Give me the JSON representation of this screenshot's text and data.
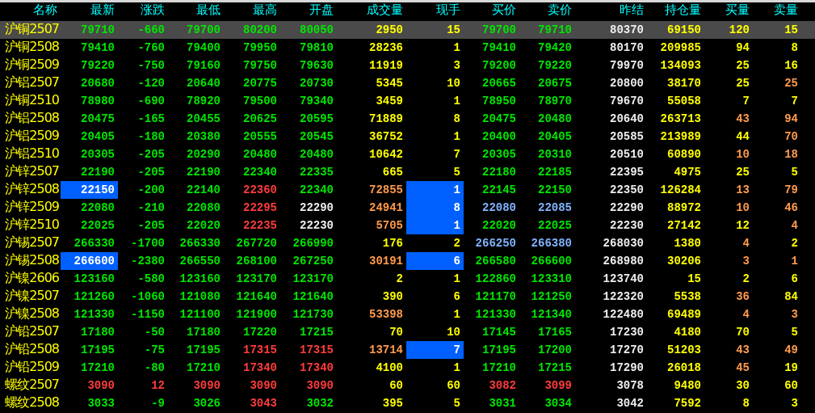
{
  "columns": [
    "名称",
    "最新",
    "涨跌",
    "最低",
    "最高",
    "开盘",
    "成交量",
    "现手",
    "买价",
    "卖价",
    "昨结",
    "持仓量",
    "买量",
    "卖量"
  ],
  "rows": [
    {
      "name": "沪铜2507",
      "selected": true,
      "cells": [
        {
          "text": "79710",
          "color": "#00e600",
          "highlighted": false
        },
        {
          "text": "-660",
          "color": "#00e600",
          "highlighted": false
        },
        {
          "text": "79700",
          "color": "#00e600",
          "highlighted": false
        },
        {
          "text": "80200",
          "color": "#00e600",
          "highlighted": false
        },
        {
          "text": "80050",
          "color": "#00e600",
          "highlighted": false
        },
        {
          "text": "2950",
          "color": "#ffff00",
          "highlighted": false
        },
        {
          "text": "15",
          "color": "#ffff00",
          "highlighted": false
        },
        {
          "text": "79700",
          "color": "#00e600",
          "highlighted": false
        },
        {
          "text": "79710",
          "color": "#00e600",
          "highlighted": false
        },
        {
          "text": "80370",
          "color": "#eeeeee",
          "highlighted": false
        },
        {
          "text": "69150",
          "color": "#ffff00",
          "highlighted": false
        },
        {
          "text": "120",
          "color": "#ffff00",
          "highlighted": false
        },
        {
          "text": "15",
          "color": "#ffff00",
          "highlighted": false
        }
      ]
    },
    {
      "name": "沪铜2508",
      "selected": false,
      "cells": [
        {
          "text": "79410",
          "color": "#00e600",
          "highlighted": false
        },
        {
          "text": "-760",
          "color": "#00e600",
          "highlighted": false
        },
        {
          "text": "79400",
          "color": "#00e600",
          "highlighted": false
        },
        {
          "text": "79950",
          "color": "#00e600",
          "highlighted": false
        },
        {
          "text": "79810",
          "color": "#00e600",
          "highlighted": false
        },
        {
          "text": "28236",
          "color": "#ffff00",
          "highlighted": false
        },
        {
          "text": "1",
          "color": "#ffff00",
          "highlighted": false
        },
        {
          "text": "79410",
          "color": "#00e600",
          "highlighted": false
        },
        {
          "text": "79420",
          "color": "#00e600",
          "highlighted": false
        },
        {
          "text": "80170",
          "color": "#eeeeee",
          "highlighted": false
        },
        {
          "text": "209985",
          "color": "#ffff00",
          "highlighted": false
        },
        {
          "text": "94",
          "color": "#ffff00",
          "highlighted": false
        },
        {
          "text": "8",
          "color": "#ffff00",
          "highlighted": false
        }
      ]
    },
    {
      "name": "沪铜2509",
      "selected": false,
      "cells": [
        {
          "text": "79220",
          "color": "#00e600",
          "highlighted": false
        },
        {
          "text": "-750",
          "color": "#00e600",
          "highlighted": false
        },
        {
          "text": "79160",
          "color": "#00e600",
          "highlighted": false
        },
        {
          "text": "79750",
          "color": "#00e600",
          "highlighted": false
        },
        {
          "text": "79630",
          "color": "#00e600",
          "highlighted": false
        },
        {
          "text": "11919",
          "color": "#ffff00",
          "highlighted": false
        },
        {
          "text": "3",
          "color": "#ffff00",
          "highlighted": false
        },
        {
          "text": "79200",
          "color": "#00e600",
          "highlighted": false
        },
        {
          "text": "79220",
          "color": "#00e600",
          "highlighted": false
        },
        {
          "text": "79970",
          "color": "#eeeeee",
          "highlighted": false
        },
        {
          "text": "134093",
          "color": "#ffff00",
          "highlighted": false
        },
        {
          "text": "25",
          "color": "#ffff00",
          "highlighted": false
        },
        {
          "text": "16",
          "color": "#ffff00",
          "highlighted": false
        }
      ]
    },
    {
      "name": "沪铝2507",
      "selected": false,
      "cells": [
        {
          "text": "20680",
          "color": "#00e600",
          "highlighted": false
        },
        {
          "text": "-120",
          "color": "#00e600",
          "highlighted": false
        },
        {
          "text": "20640",
          "color": "#00e600",
          "highlighted": false
        },
        {
          "text": "20775",
          "color": "#00e600",
          "highlighted": false
        },
        {
          "text": "20730",
          "color": "#00e600",
          "highlighted": false
        },
        {
          "text": "5345",
          "color": "#ffff00",
          "highlighted": false
        },
        {
          "text": "10",
          "color": "#ffff00",
          "highlighted": false
        },
        {
          "text": "20665",
          "color": "#00e600",
          "highlighted": false
        },
        {
          "text": "20675",
          "color": "#00e600",
          "highlighted": false
        },
        {
          "text": "20800",
          "color": "#eeeeee",
          "highlighted": false
        },
        {
          "text": "38170",
          "color": "#ffff00",
          "highlighted": false
        },
        {
          "text": "25",
          "color": "#ffff00",
          "highlighted": false
        },
        {
          "text": "25",
          "color": "#ff9a4c",
          "highlighted": false
        }
      ]
    },
    {
      "name": "沪铜2510",
      "selected": false,
      "cells": [
        {
          "text": "78980",
          "color": "#00e600",
          "highlighted": false
        },
        {
          "text": "-690",
          "color": "#00e600",
          "highlighted": false
        },
        {
          "text": "78920",
          "color": "#00e600",
          "highlighted": false
        },
        {
          "text": "79500",
          "color": "#00e600",
          "highlighted": false
        },
        {
          "text": "79340",
          "color": "#00e600",
          "highlighted": false
        },
        {
          "text": "3459",
          "color": "#ffff00",
          "highlighted": false
        },
        {
          "text": "1",
          "color": "#ffff00",
          "highlighted": false
        },
        {
          "text": "78950",
          "color": "#00e600",
          "highlighted": false
        },
        {
          "text": "78970",
          "color": "#00e600",
          "highlighted": false
        },
        {
          "text": "79670",
          "color": "#eeeeee",
          "highlighted": false
        },
        {
          "text": "55058",
          "color": "#ffff00",
          "highlighted": false
        },
        {
          "text": "7",
          "color": "#ffff00",
          "highlighted": false
        },
        {
          "text": "7",
          "color": "#ffff00",
          "highlighted": false
        }
      ]
    },
    {
      "name": "沪铝2508",
      "selected": false,
      "cells": [
        {
          "text": "20475",
          "color": "#00e600",
          "highlighted": false
        },
        {
          "text": "-165",
          "color": "#00e600",
          "highlighted": false
        },
        {
          "text": "20455",
          "color": "#00e600",
          "highlighted": false
        },
        {
          "text": "20625",
          "color": "#00e600",
          "highlighted": false
        },
        {
          "text": "20595",
          "color": "#00e600",
          "highlighted": false
        },
        {
          "text": "71889",
          "color": "#ffff00",
          "highlighted": false
        },
        {
          "text": "8",
          "color": "#ffff00",
          "highlighted": false
        },
        {
          "text": "20475",
          "color": "#00e600",
          "highlighted": false
        },
        {
          "text": "20480",
          "color": "#00e600",
          "highlighted": false
        },
        {
          "text": "20640",
          "color": "#eeeeee",
          "highlighted": false
        },
        {
          "text": "263713",
          "color": "#ffff00",
          "highlighted": false
        },
        {
          "text": "43",
          "color": "#ff9a4c",
          "highlighted": false
        },
        {
          "text": "94",
          "color": "#ff9a4c",
          "highlighted": false
        }
      ]
    },
    {
      "name": "沪铝2509",
      "selected": false,
      "cells": [
        {
          "text": "20405",
          "color": "#00e600",
          "highlighted": false
        },
        {
          "text": "-180",
          "color": "#00e600",
          "highlighted": false
        },
        {
          "text": "20380",
          "color": "#00e600",
          "highlighted": false
        },
        {
          "text": "20555",
          "color": "#00e600",
          "highlighted": false
        },
        {
          "text": "20545",
          "color": "#00e600",
          "highlighted": false
        },
        {
          "text": "36752",
          "color": "#ffff00",
          "highlighted": false
        },
        {
          "text": "1",
          "color": "#ffff00",
          "highlighted": false
        },
        {
          "text": "20400",
          "color": "#00e600",
          "highlighted": false
        },
        {
          "text": "20405",
          "color": "#00e600",
          "highlighted": false
        },
        {
          "text": "20585",
          "color": "#eeeeee",
          "highlighted": false
        },
        {
          "text": "213989",
          "color": "#ffff00",
          "highlighted": false
        },
        {
          "text": "44",
          "color": "#ffff00",
          "highlighted": false
        },
        {
          "text": "70",
          "color": "#ff9a4c",
          "highlighted": false
        }
      ]
    },
    {
      "name": "沪铝2510",
      "selected": false,
      "cells": [
        {
          "text": "20305",
          "color": "#00e600",
          "highlighted": false
        },
        {
          "text": "-205",
          "color": "#00e600",
          "highlighted": false
        },
        {
          "text": "20290",
          "color": "#00e600",
          "highlighted": false
        },
        {
          "text": "20480",
          "color": "#00e600",
          "highlighted": false
        },
        {
          "text": "20480",
          "color": "#00e600",
          "highlighted": false
        },
        {
          "text": "10642",
          "color": "#ffff00",
          "highlighted": false
        },
        {
          "text": "7",
          "color": "#ffff00",
          "highlighted": false
        },
        {
          "text": "20305",
          "color": "#00e600",
          "highlighted": false
        },
        {
          "text": "20310",
          "color": "#00e600",
          "highlighted": false
        },
        {
          "text": "20510",
          "color": "#eeeeee",
          "highlighted": false
        },
        {
          "text": "60890",
          "color": "#ffff00",
          "highlighted": false
        },
        {
          "text": "10",
          "color": "#ff9a4c",
          "highlighted": false
        },
        {
          "text": "18",
          "color": "#ff9a4c",
          "highlighted": false
        }
      ]
    },
    {
      "name": "沪锌2507",
      "selected": false,
      "cells": [
        {
          "text": "22190",
          "color": "#00e600",
          "highlighted": false
        },
        {
          "text": "-205",
          "color": "#00e600",
          "highlighted": false
        },
        {
          "text": "22190",
          "color": "#00e600",
          "highlighted": false
        },
        {
          "text": "22340",
          "color": "#00e600",
          "highlighted": false
        },
        {
          "text": "22335",
          "color": "#00e600",
          "highlighted": false
        },
        {
          "text": "665",
          "color": "#ffff00",
          "highlighted": false
        },
        {
          "text": "5",
          "color": "#ffff00",
          "highlighted": false
        },
        {
          "text": "22180",
          "color": "#00e600",
          "highlighted": false
        },
        {
          "text": "22185",
          "color": "#00e600",
          "highlighted": false
        },
        {
          "text": "22395",
          "color": "#eeeeee",
          "highlighted": false
        },
        {
          "text": "4975",
          "color": "#ffff00",
          "highlighted": false
        },
        {
          "text": "25",
          "color": "#ffff00",
          "highlighted": false
        },
        {
          "text": "5",
          "color": "#ffff00",
          "highlighted": false
        }
      ]
    },
    {
      "name": "沪锌2508",
      "selected": false,
      "cells": [
        {
          "text": "22150",
          "color": "#ffffff",
          "highlighted": true
        },
        {
          "text": "-200",
          "color": "#00e600",
          "highlighted": false
        },
        {
          "text": "22140",
          "color": "#00e600",
          "highlighted": false
        },
        {
          "text": "22360",
          "color": "#ff3c3c",
          "highlighted": false
        },
        {
          "text": "22340",
          "color": "#00e600",
          "highlighted": false
        },
        {
          "text": "72855",
          "color": "#ff9a4c",
          "highlighted": false
        },
        {
          "text": "1",
          "color": "#ffffff",
          "highlighted": true
        },
        {
          "text": "22145",
          "color": "#00e600",
          "highlighted": false
        },
        {
          "text": "22150",
          "color": "#00e600",
          "highlighted": false
        },
        {
          "text": "22350",
          "color": "#eeeeee",
          "highlighted": false
        },
        {
          "text": "126284",
          "color": "#ffff00",
          "highlighted": false
        },
        {
          "text": "13",
          "color": "#ff9a4c",
          "highlighted": false
        },
        {
          "text": "79",
          "color": "#ff9a4c",
          "highlighted": false
        }
      ]
    },
    {
      "name": "沪锌2509",
      "selected": false,
      "cells": [
        {
          "text": "22080",
          "color": "#00e600",
          "highlighted": false
        },
        {
          "text": "-210",
          "color": "#00e600",
          "highlighted": false
        },
        {
          "text": "22080",
          "color": "#00e600",
          "highlighted": false
        },
        {
          "text": "22295",
          "color": "#ff3c3c",
          "highlighted": false
        },
        {
          "text": "22290",
          "color": "#eeeeee",
          "highlighted": false
        },
        {
          "text": "24941",
          "color": "#ff9a4c",
          "highlighted": false
        },
        {
          "text": "8",
          "color": "#ffffff",
          "highlighted": true
        },
        {
          "text": "22080",
          "color": "#80b4ff",
          "highlighted": false
        },
        {
          "text": "22085",
          "color": "#80b4ff",
          "highlighted": false
        },
        {
          "text": "22290",
          "color": "#eeeeee",
          "highlighted": false
        },
        {
          "text": "88972",
          "color": "#ffff00",
          "highlighted": false
        },
        {
          "text": "10",
          "color": "#ff9a4c",
          "highlighted": false
        },
        {
          "text": "46",
          "color": "#ff9a4c",
          "highlighted": false
        }
      ]
    },
    {
      "name": "沪锌2510",
      "selected": false,
      "cells": [
        {
          "text": "22025",
          "color": "#00e600",
          "highlighted": false
        },
        {
          "text": "-205",
          "color": "#00e600",
          "highlighted": false
        },
        {
          "text": "22020",
          "color": "#00e600",
          "highlighted": false
        },
        {
          "text": "22235",
          "color": "#ff3c3c",
          "highlighted": false
        },
        {
          "text": "22230",
          "color": "#eeeeee",
          "highlighted": false
        },
        {
          "text": "5705",
          "color": "#ff9a4c",
          "highlighted": false
        },
        {
          "text": "1",
          "color": "#ffffff",
          "highlighted": true
        },
        {
          "text": "22020",
          "color": "#00e600",
          "highlighted": false
        },
        {
          "text": "22025",
          "color": "#00e600",
          "highlighted": false
        },
        {
          "text": "22230",
          "color": "#eeeeee",
          "highlighted": false
        },
        {
          "text": "27142",
          "color": "#ffff00",
          "highlighted": false
        },
        {
          "text": "12",
          "color": "#ffff00",
          "highlighted": false
        },
        {
          "text": "4",
          "color": "#ff9a4c",
          "highlighted": false
        }
      ]
    },
    {
      "name": "沪锡2507",
      "selected": false,
      "cells": [
        {
          "text": "266330",
          "color": "#00e600",
          "highlighted": false
        },
        {
          "text": "-1700",
          "color": "#00e600",
          "highlighted": false
        },
        {
          "text": "266330",
          "color": "#00e600",
          "highlighted": false
        },
        {
          "text": "267720",
          "color": "#00e600",
          "highlighted": false
        },
        {
          "text": "266990",
          "color": "#00e600",
          "highlighted": false
        },
        {
          "text": "176",
          "color": "#ffff00",
          "highlighted": false
        },
        {
          "text": "2",
          "color": "#ffff00",
          "highlighted": false
        },
        {
          "text": "266250",
          "color": "#80b4ff",
          "highlighted": false
        },
        {
          "text": "266380",
          "color": "#80b4ff",
          "highlighted": false
        },
        {
          "text": "268030",
          "color": "#eeeeee",
          "highlighted": false
        },
        {
          "text": "1380",
          "color": "#ffff00",
          "highlighted": false
        },
        {
          "text": "4",
          "color": "#ff9a4c",
          "highlighted": false
        },
        {
          "text": "2",
          "color": "#ffff00",
          "highlighted": false
        }
      ]
    },
    {
      "name": "沪锡2508",
      "selected": false,
      "cells": [
        {
          "text": "266600",
          "color": "#ffffff",
          "highlighted": true
        },
        {
          "text": "-2380",
          "color": "#00e600",
          "highlighted": false
        },
        {
          "text": "266550",
          "color": "#00e600",
          "highlighted": false
        },
        {
          "text": "268100",
          "color": "#00e600",
          "highlighted": false
        },
        {
          "text": "267250",
          "color": "#00e600",
          "highlighted": false
        },
        {
          "text": "30191",
          "color": "#ff9a4c",
          "highlighted": false
        },
        {
          "text": "6",
          "color": "#ffffff",
          "highlighted": true
        },
        {
          "text": "266580",
          "color": "#00e600",
          "highlighted": false
        },
        {
          "text": "266600",
          "color": "#00e600",
          "highlighted": false
        },
        {
          "text": "268980",
          "color": "#eeeeee",
          "highlighted": false
        },
        {
          "text": "30206",
          "color": "#ffff00",
          "highlighted": false
        },
        {
          "text": "3",
          "color": "#ff9a4c",
          "highlighted": false
        },
        {
          "text": "1",
          "color": "#ff9a4c",
          "highlighted": false
        }
      ]
    },
    {
      "name": "沪镍2606",
      "selected": false,
      "cells": [
        {
          "text": "123160",
          "color": "#00e600",
          "highlighted": false
        },
        {
          "text": "-580",
          "color": "#00e600",
          "highlighted": false
        },
        {
          "text": "123160",
          "color": "#00e600",
          "highlighted": false
        },
        {
          "text": "123170",
          "color": "#00e600",
          "highlighted": false
        },
        {
          "text": "123170",
          "color": "#00e600",
          "highlighted": false
        },
        {
          "text": "2",
          "color": "#ffff00",
          "highlighted": false
        },
        {
          "text": "1",
          "color": "#ffff00",
          "highlighted": false
        },
        {
          "text": "122860",
          "color": "#00e600",
          "highlighted": false
        },
        {
          "text": "123310",
          "color": "#00e600",
          "highlighted": false
        },
        {
          "text": "123740",
          "color": "#eeeeee",
          "highlighted": false
        },
        {
          "text": "15",
          "color": "#ffff00",
          "highlighted": false
        },
        {
          "text": "2",
          "color": "#ffff00",
          "highlighted": false
        },
        {
          "text": "6",
          "color": "#ffff00",
          "highlighted": false
        }
      ]
    },
    {
      "name": "沪镍2507",
      "selected": false,
      "cells": [
        {
          "text": "121260",
          "color": "#00e600",
          "highlighted": false
        },
        {
          "text": "-1060",
          "color": "#00e600",
          "highlighted": false
        },
        {
          "text": "121080",
          "color": "#00e600",
          "highlighted": false
        },
        {
          "text": "121640",
          "color": "#00e600",
          "highlighted": false
        },
        {
          "text": "121640",
          "color": "#00e600",
          "highlighted": false
        },
        {
          "text": "390",
          "color": "#ffff00",
          "highlighted": false
        },
        {
          "text": "6",
          "color": "#ffff00",
          "highlighted": false
        },
        {
          "text": "121170",
          "color": "#00e600",
          "highlighted": false
        },
        {
          "text": "121250",
          "color": "#00e600",
          "highlighted": false
        },
        {
          "text": "122320",
          "color": "#eeeeee",
          "highlighted": false
        },
        {
          "text": "5538",
          "color": "#ffff00",
          "highlighted": false
        },
        {
          "text": "36",
          "color": "#ff9a4c",
          "highlighted": false
        },
        {
          "text": "84",
          "color": "#ffff00",
          "highlighted": false
        }
      ]
    },
    {
      "name": "沪镍2508",
      "selected": false,
      "cells": [
        {
          "text": "121330",
          "color": "#00e600",
          "highlighted": false
        },
        {
          "text": "-1150",
          "color": "#00e600",
          "highlighted": false
        },
        {
          "text": "121100",
          "color": "#00e600",
          "highlighted": false
        },
        {
          "text": "121900",
          "color": "#00e600",
          "highlighted": false
        },
        {
          "text": "121730",
          "color": "#00e600",
          "highlighted": false
        },
        {
          "text": "53398",
          "color": "#ff9a4c",
          "highlighted": false
        },
        {
          "text": "1",
          "color": "#ffff00",
          "highlighted": false
        },
        {
          "text": "121330",
          "color": "#00e600",
          "highlighted": false
        },
        {
          "text": "121340",
          "color": "#00e600",
          "highlighted": false
        },
        {
          "text": "122480",
          "color": "#eeeeee",
          "highlighted": false
        },
        {
          "text": "69489",
          "color": "#ffff00",
          "highlighted": false
        },
        {
          "text": "4",
          "color": "#ff9a4c",
          "highlighted": false
        },
        {
          "text": "3",
          "color": "#ff9a4c",
          "highlighted": false
        }
      ]
    },
    {
      "name": "沪铅2507",
      "selected": false,
      "cells": [
        {
          "text": "17180",
          "color": "#00e600",
          "highlighted": false
        },
        {
          "text": "-50",
          "color": "#00e600",
          "highlighted": false
        },
        {
          "text": "17180",
          "color": "#00e600",
          "highlighted": false
        },
        {
          "text": "17220",
          "color": "#00e600",
          "highlighted": false
        },
        {
          "text": "17215",
          "color": "#00e600",
          "highlighted": false
        },
        {
          "text": "70",
          "color": "#ffff00",
          "highlighted": false
        },
        {
          "text": "10",
          "color": "#ffff00",
          "highlighted": false
        },
        {
          "text": "17145",
          "color": "#00e600",
          "highlighted": false
        },
        {
          "text": "17165",
          "color": "#00e600",
          "highlighted": false
        },
        {
          "text": "17230",
          "color": "#eeeeee",
          "highlighted": false
        },
        {
          "text": "4180",
          "color": "#ffff00",
          "highlighted": false
        },
        {
          "text": "70",
          "color": "#ffff00",
          "highlighted": false
        },
        {
          "text": "5",
          "color": "#ffff00",
          "highlighted": false
        }
      ]
    },
    {
      "name": "沪铅2508",
      "selected": false,
      "cells": [
        {
          "text": "17195",
          "color": "#00e600",
          "highlighted": false
        },
        {
          "text": "-75",
          "color": "#00e600",
          "highlighted": false
        },
        {
          "text": "17195",
          "color": "#00e600",
          "highlighted": false
        },
        {
          "text": "17315",
          "color": "#ff3c3c",
          "highlighted": false
        },
        {
          "text": "17315",
          "color": "#ff3c3c",
          "highlighted": false
        },
        {
          "text": "13714",
          "color": "#ff9a4c",
          "highlighted": false
        },
        {
          "text": "7",
          "color": "#ffffff",
          "highlighted": true
        },
        {
          "text": "17195",
          "color": "#00e600",
          "highlighted": false
        },
        {
          "text": "17200",
          "color": "#00e600",
          "highlighted": false
        },
        {
          "text": "17270",
          "color": "#eeeeee",
          "highlighted": false
        },
        {
          "text": "51203",
          "color": "#ffff00",
          "highlighted": false
        },
        {
          "text": "43",
          "color": "#ff9a4c",
          "highlighted": false
        },
        {
          "text": "49",
          "color": "#ff9a4c",
          "highlighted": false
        }
      ]
    },
    {
      "name": "沪铅2509",
      "selected": false,
      "cells": [
        {
          "text": "17210",
          "color": "#00e600",
          "highlighted": false
        },
        {
          "text": "-80",
          "color": "#00e600",
          "highlighted": false
        },
        {
          "text": "17210",
          "color": "#00e600",
          "highlighted": false
        },
        {
          "text": "17340",
          "color": "#ff3c3c",
          "highlighted": false
        },
        {
          "text": "17340",
          "color": "#ff3c3c",
          "highlighted": false
        },
        {
          "text": "4100",
          "color": "#ffff00",
          "highlighted": false
        },
        {
          "text": "1",
          "color": "#ffff00",
          "highlighted": false
        },
        {
          "text": "17210",
          "color": "#00e600",
          "highlighted": false
        },
        {
          "text": "17215",
          "color": "#00e600",
          "highlighted": false
        },
        {
          "text": "17290",
          "color": "#eeeeee",
          "highlighted": false
        },
        {
          "text": "26018",
          "color": "#ffff00",
          "highlighted": false
        },
        {
          "text": "45",
          "color": "#ff9a4c",
          "highlighted": false
        },
        {
          "text": "19",
          "color": "#ffff00",
          "highlighted": false
        }
      ]
    },
    {
      "name": "螺纹2507",
      "selected": false,
      "cells": [
        {
          "text": "3090",
          "color": "#ff3c3c",
          "highlighted": false
        },
        {
          "text": "12",
          "color": "#ff3c3c",
          "highlighted": false
        },
        {
          "text": "3090",
          "color": "#ff3c3c",
          "highlighted": false
        },
        {
          "text": "3090",
          "color": "#ff3c3c",
          "highlighted": false
        },
        {
          "text": "3090",
          "color": "#ff3c3c",
          "highlighted": false
        },
        {
          "text": "60",
          "color": "#ffff00",
          "highlighted": false
        },
        {
          "text": "60",
          "color": "#ffff00",
          "highlighted": false
        },
        {
          "text": "3082",
          "color": "#ff3c3c",
          "highlighted": false
        },
        {
          "text": "3099",
          "color": "#ff3c3c",
          "highlighted": false
        },
        {
          "text": "3078",
          "color": "#eeeeee",
          "highlighted": false
        },
        {
          "text": "9480",
          "color": "#ffff00",
          "highlighted": false
        },
        {
          "text": "30",
          "color": "#ffff00",
          "highlighted": false
        },
        {
          "text": "60",
          "color": "#ffff00",
          "highlighted": false
        }
      ]
    },
    {
      "name": "螺纹2508",
      "selected": false,
      "cells": [
        {
          "text": "3033",
          "color": "#00e600",
          "highlighted": false
        },
        {
          "text": "-9",
          "color": "#00e600",
          "highlighted": false
        },
        {
          "text": "3026",
          "color": "#00e600",
          "highlighted": false
        },
        {
          "text": "3043",
          "color": "#ff3c3c",
          "highlighted": false
        },
        {
          "text": "3032",
          "color": "#00e600",
          "highlighted": false
        },
        {
          "text": "395",
          "color": "#ffff00",
          "highlighted": false
        },
        {
          "text": "5",
          "color": "#ffff00",
          "highlighted": false
        },
        {
          "text": "3031",
          "color": "#00e600",
          "highlighted": false
        },
        {
          "text": "3034",
          "color": "#00e600",
          "highlighted": false
        },
        {
          "text": "3042",
          "color": "#eeeeee",
          "highlighted": false
        },
        {
          "text": "7592",
          "color": "#ffff00",
          "highlighted": false
        },
        {
          "text": "8",
          "color": "#ffff00",
          "highlighted": false
        },
        {
          "text": "3",
          "color": "#ffff00",
          "highlighted": false
        }
      ]
    }
  ]
}
